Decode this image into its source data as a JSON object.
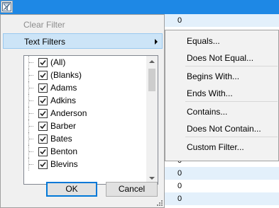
{
  "grid": {
    "rows": [
      "0",
      "",
      "",
      "",
      "",
      "",
      "",
      "",
      "",
      "",
      "",
      "0",
      "0",
      "0",
      "0"
    ]
  },
  "filter_button": {
    "icon": "filter-icon"
  },
  "dropdown": {
    "clear_filter_label": "Clear Filter",
    "text_filters_label": "Text Filters",
    "list_items": [
      {
        "label": "(All)",
        "checked": true
      },
      {
        "label": "(Blanks)",
        "checked": true
      },
      {
        "label": "Adams",
        "checked": true
      },
      {
        "label": "Adkins",
        "checked": true
      },
      {
        "label": "Anderson",
        "checked": true
      },
      {
        "label": "Barber",
        "checked": true
      },
      {
        "label": "Bates",
        "checked": true
      },
      {
        "label": "Benton",
        "checked": true
      },
      {
        "label": "Blevins",
        "checked": true
      }
    ],
    "ok_label": "OK",
    "cancel_label": "Cancel"
  },
  "submenu": {
    "items": [
      "Equals...",
      "Does Not Equal...",
      "Begins With...",
      "Ends With...",
      "Contains...",
      "Does Not Contain...",
      "Custom Filter..."
    ]
  },
  "colors": {
    "header": "#1e88e5",
    "selection": "#cce4f7",
    "row_alt": "#e3f0fb"
  }
}
